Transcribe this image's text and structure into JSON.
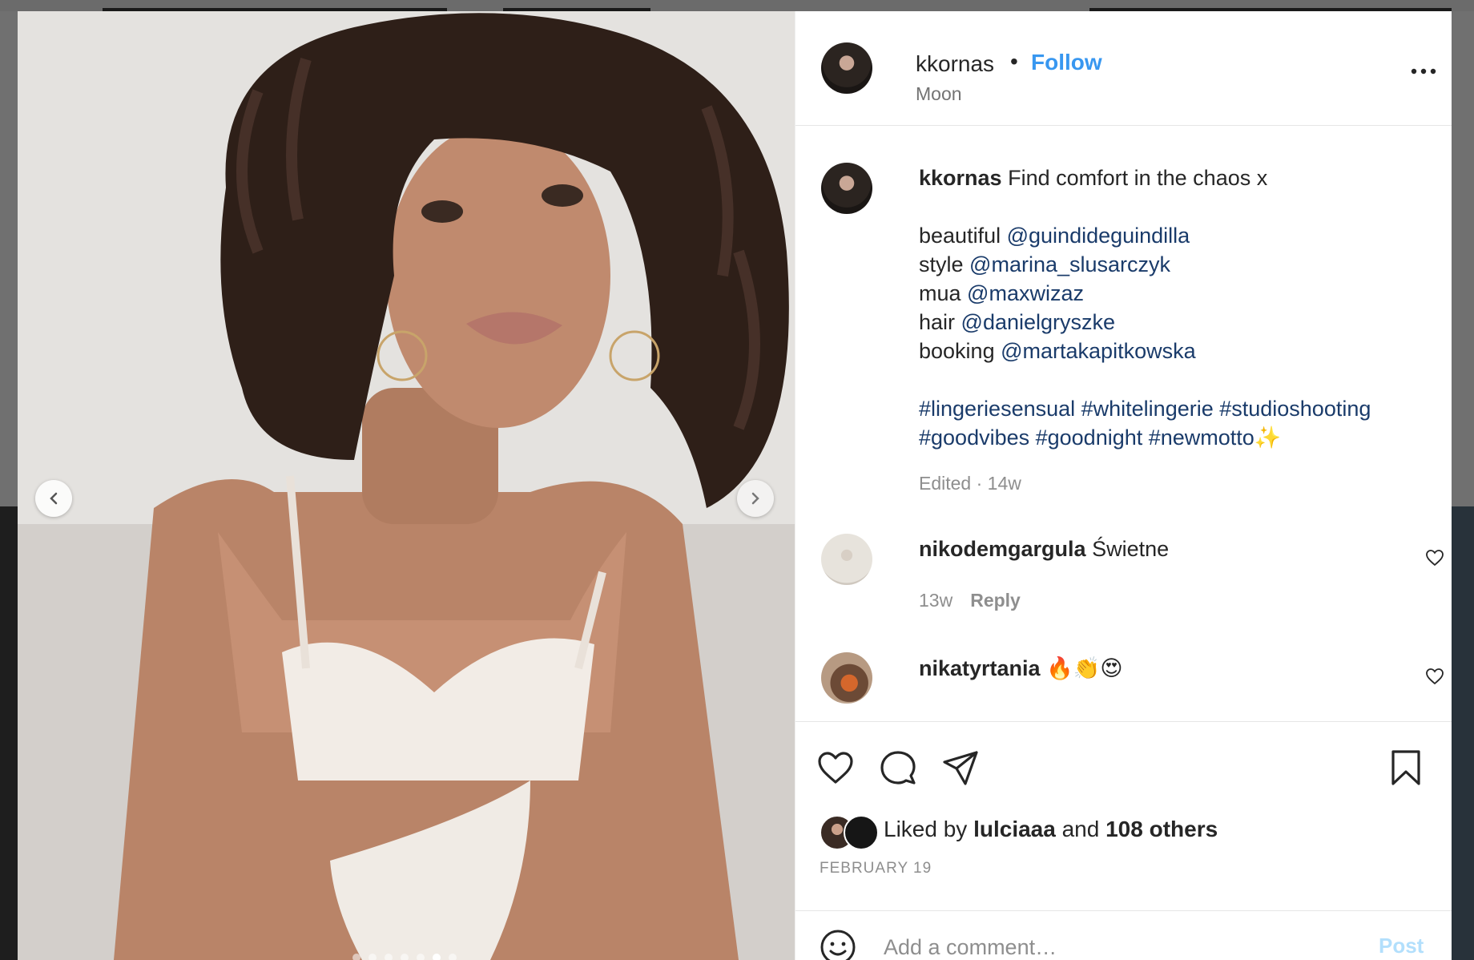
{
  "post": {
    "username": "kkornas",
    "separator": "•",
    "follow_label": "Follow",
    "location": "Moon",
    "caption": {
      "username": "kkornas",
      "text": "Find comfort in the chaos x",
      "credits": [
        {
          "role": "beautiful",
          "handle": "@guindideguindilla"
        },
        {
          "role": "style",
          "handle": "@marina_slusarczyk"
        },
        {
          "role": "mua",
          "handle": "@maxwizaz"
        },
        {
          "role": "hair",
          "handle": "@danielgryszke"
        },
        {
          "role": "booking",
          "handle": "@martakapitkowska"
        }
      ],
      "hashtags_line1": "#lingeriesensual #whitelingerie #studioshooting",
      "hashtags_line2": "#goodvibes #goodnight #newmotto",
      "hashtags_emoji": "✨",
      "meta": "Edited · 14w"
    },
    "comments": [
      {
        "username": "nikodemgargula",
        "text": "Świetne",
        "time": "13w",
        "reply_label": "Reply"
      },
      {
        "username": "nikatyrtania",
        "text": "🔥👏😍"
      }
    ],
    "likes": {
      "prefix": "Liked by",
      "user": "lulciaaa",
      "conjunction": "and",
      "others": "108 others"
    },
    "date": "FEBRUARY 19",
    "add_comment": {
      "placeholder": "Add a comment…",
      "post_label": "Post"
    }
  },
  "carousel": {
    "total_slides": 7,
    "active_slide": 6
  },
  "colors": {
    "link_blue": "#3897f0",
    "mention_blue": "#1a3b6a",
    "post_disabled": "#b2dffc",
    "muted_text": "#8e8e8e"
  },
  "icons": [
    "more-icon",
    "heart-icon",
    "comment-icon",
    "share-icon",
    "bookmark-icon",
    "emoji-icon",
    "chevron-left-icon",
    "chevron-right-icon"
  ]
}
